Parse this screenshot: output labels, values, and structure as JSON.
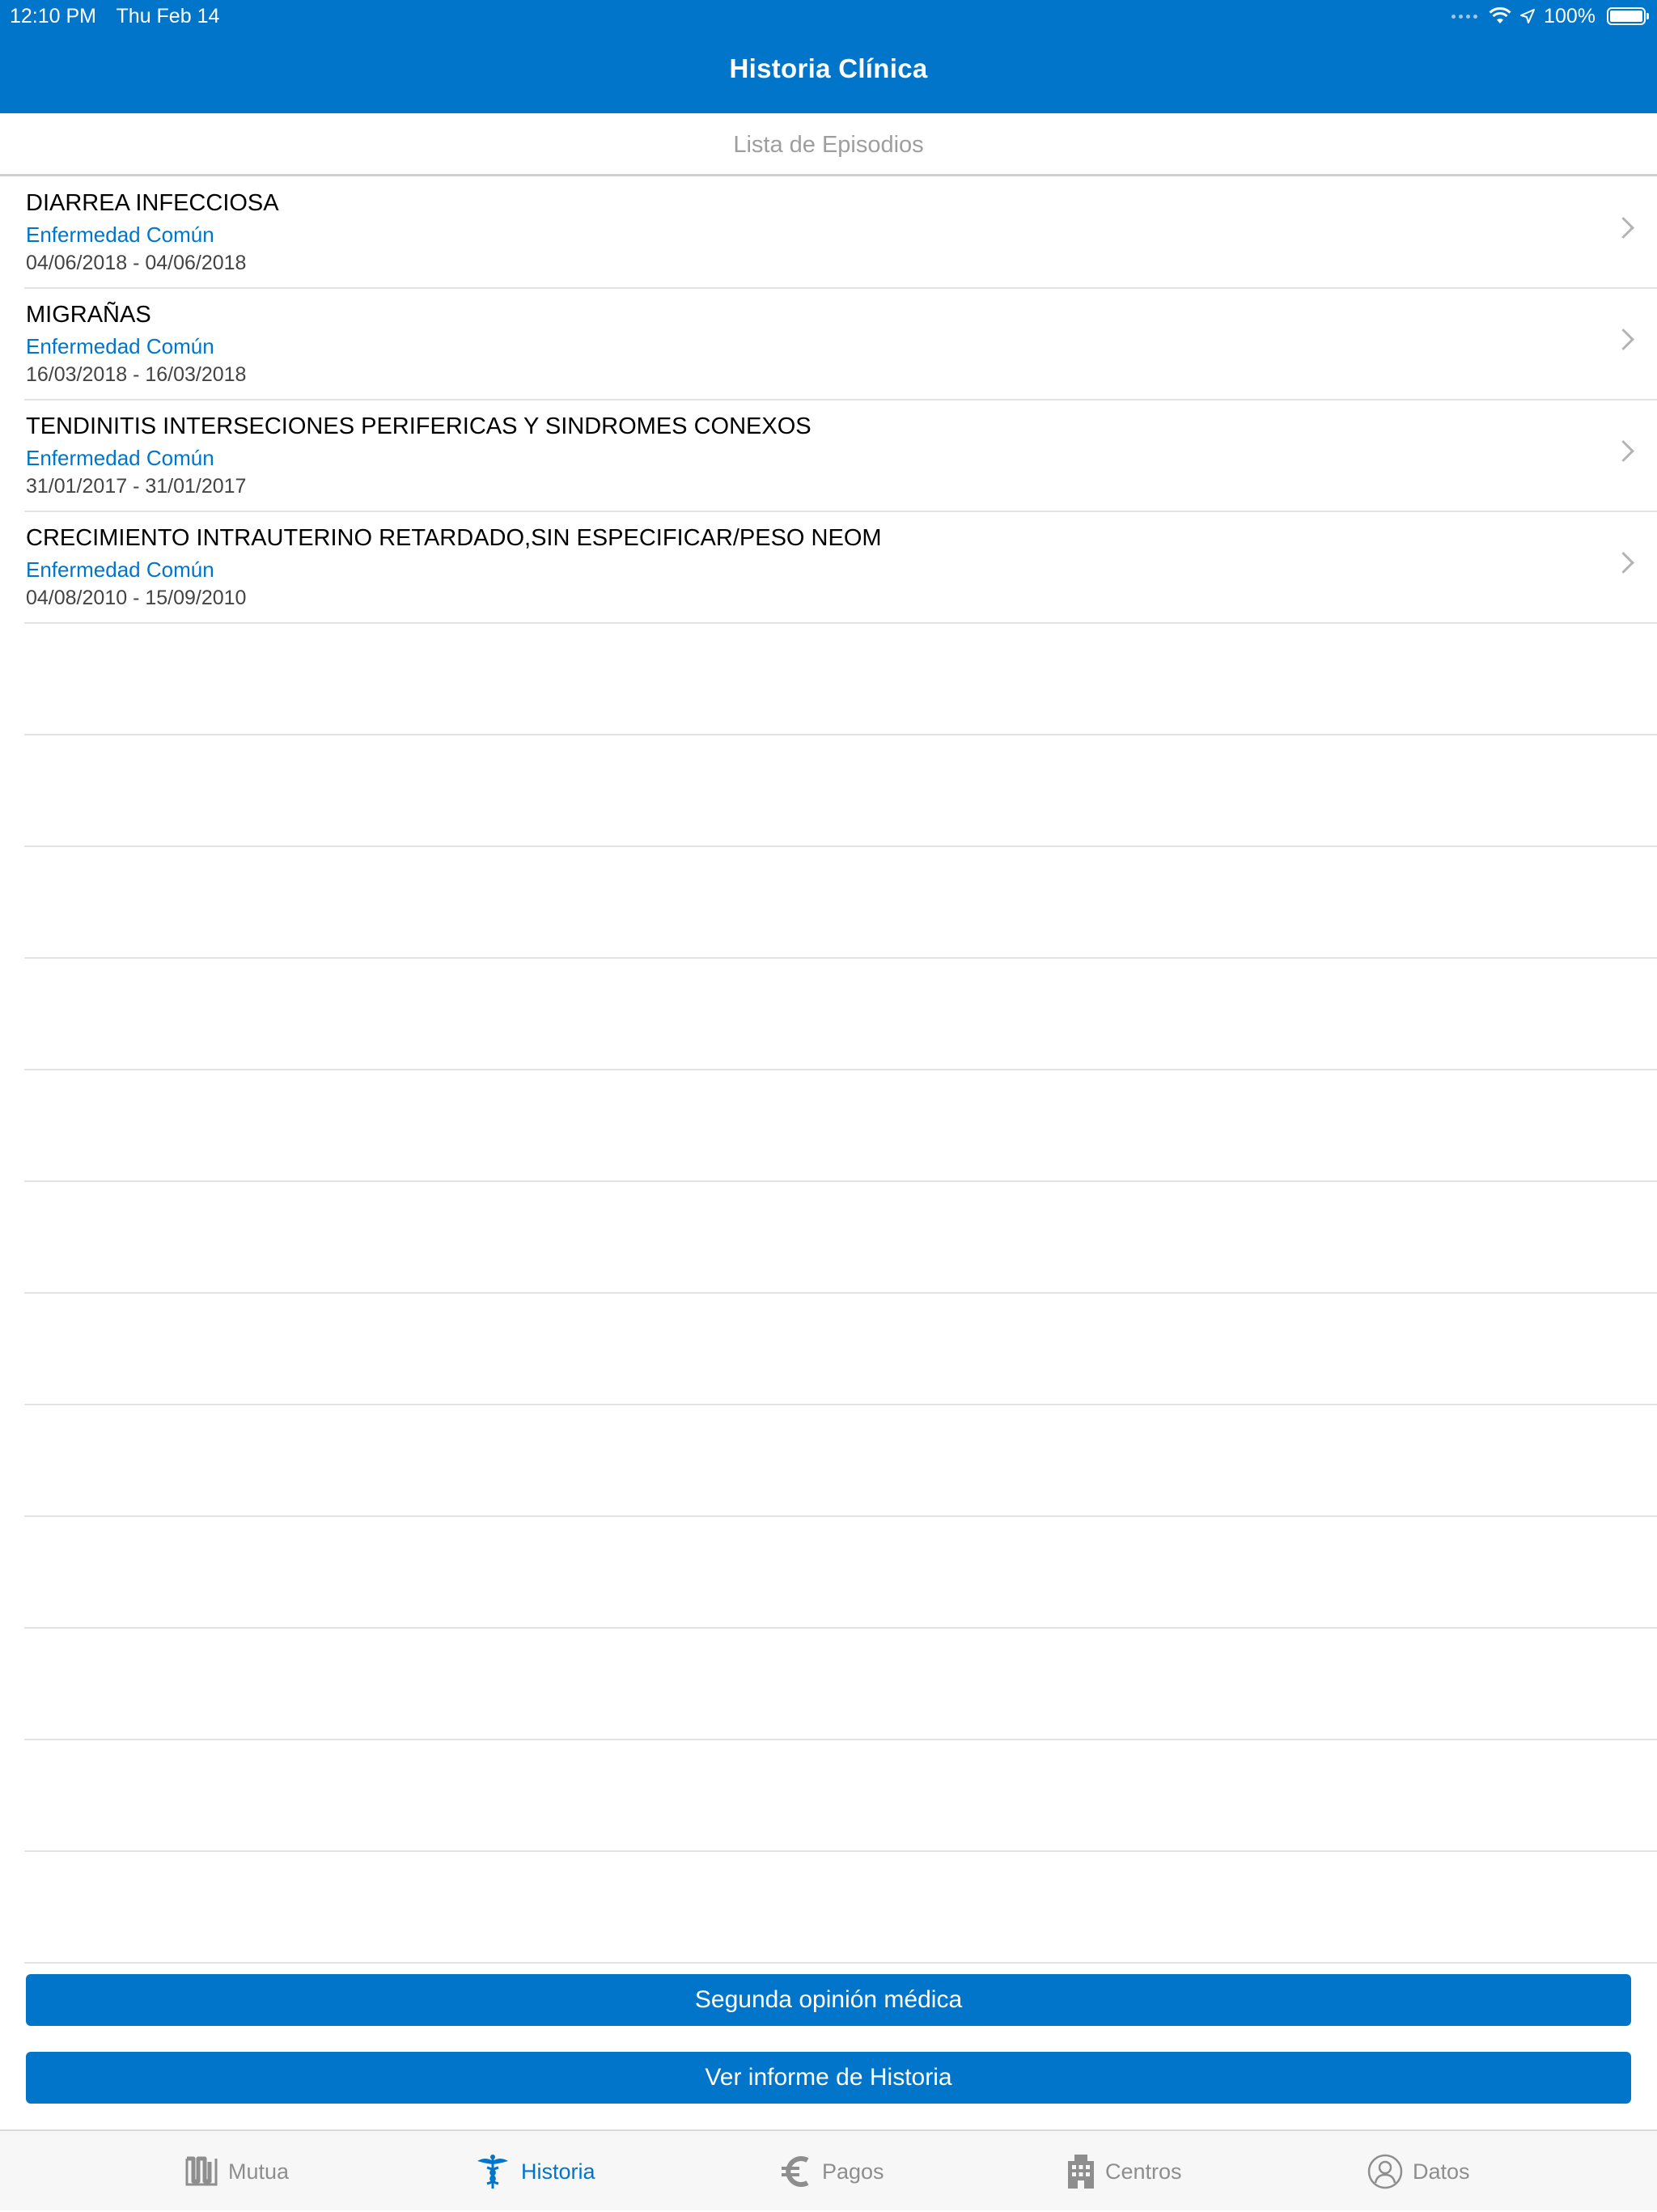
{
  "status_bar": {
    "time": "12:10 PM",
    "date": "Thu Feb 14",
    "battery": "100%"
  },
  "nav": {
    "title": "Historia Clínica"
  },
  "section_header": "Lista de Episodios",
  "episodes": [
    {
      "title": "DIARREA INFECCIOSA",
      "type": "Enfermedad Común",
      "dates": "04/06/2018 - 04/06/2018"
    },
    {
      "title": "MIGRAÑAS",
      "type": "Enfermedad Común",
      "dates": "16/03/2018 - 16/03/2018"
    },
    {
      "title": "TENDINITIS INTERSECIONES PERIFERICAS Y SINDROMES CONEXOS",
      "type": "Enfermedad Común",
      "dates": "31/01/2017 - 31/01/2017"
    },
    {
      "title": "CRECIMIENTO INTRAUTERINO RETARDADO,SIN ESPECIFICAR/PESO NEOM",
      "type": "Enfermedad Común",
      "dates": "04/08/2010 - 15/09/2010"
    }
  ],
  "buttons": {
    "second_opinion": "Segunda opinión médica",
    "report": "Ver informe de Historia"
  },
  "tabs": [
    {
      "label": "Mutua",
      "icon": "mutua-logo-icon",
      "active": false
    },
    {
      "label": "Historia",
      "icon": "caduceus-icon",
      "active": true
    },
    {
      "label": "Pagos",
      "icon": "euro-icon",
      "active": false
    },
    {
      "label": "Centros",
      "icon": "building-icon",
      "active": false
    },
    {
      "label": "Datos",
      "icon": "user-icon",
      "active": false
    }
  ],
  "colors": {
    "brand_blue": "#0075c9",
    "tab_inactive": "#8e8e8e",
    "separator": "#e3e3e3"
  }
}
